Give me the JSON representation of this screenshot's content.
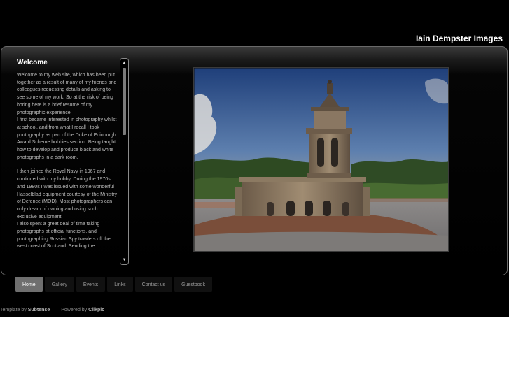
{
  "site": {
    "title": "Iain Dempster Images"
  },
  "content": {
    "heading": "Welcome",
    "paragraphs": [
      "Welcome to my web site, which has been put together as a result of many of my friends and colleagues requesting details and asking to see some of my work. So at the risk of being boring here is a brief resume of my photographic experience.\nI first became interested in photography whilst at school, and from what I recall I took photography as part of the Duke of Edinburgh Award Scheme hobbies section. Being taught how to develop and produce black and white photographs in a dark room.",
      "I then joined the Royal Navy in 1967 and continued with my hobby. During the 1970s and 1980s I was issued with some wonderful Hasselblad equipment courtesy of the Ministry of Defence (MOD). Most photographers can only dream of owning and using such exclusive equipment.\nI also spent a great deal of time taking photographs at official functions, and photographing Russian Spy trawlers off the west coast of Scotland. Sending the"
    ]
  },
  "scrollbar": {
    "up_icon": "▲",
    "down_icon": "▼",
    "position": 0.0
  },
  "nav": {
    "items": [
      {
        "label": "Home",
        "active": true
      },
      {
        "label": "Gallery",
        "active": false
      },
      {
        "label": "Events",
        "active": false
      },
      {
        "label": "Links",
        "active": false
      },
      {
        "label": "Contact us",
        "active": false
      },
      {
        "label": "Guestbook",
        "active": false
      }
    ]
  },
  "footer": {
    "template_prefix": "Template by",
    "template_author": "Subtense",
    "powered_prefix": "Powered by",
    "powered_by": "Clikpic"
  },
  "colors": {
    "background": "#000000",
    "panel_border": "#6a6a6a",
    "nav_active": "#6f6f6f",
    "nav_inactive": "#111111"
  }
}
